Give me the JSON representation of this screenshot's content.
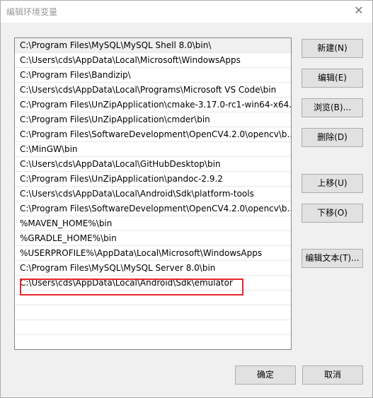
{
  "window": {
    "title": "编辑环境变量",
    "close_glyph": "✕"
  },
  "path_list": {
    "items": [
      "C:\\Program Files\\MySQL\\MySQL Shell 8.0\\bin\\",
      "C:\\Users\\cds\\AppData\\Local\\Microsoft\\WindowsApps",
      "C:\\Program Files\\Bandizip\\",
      "C:\\Users\\cds\\AppData\\Local\\Programs\\Microsoft VS Code\\bin",
      "C:\\Program Files\\UnZipApplication\\cmake-3.17.0-rc1-win64-x64...",
      "C:\\Program Files\\UnZipApplication\\cmder\\bin",
      "C:\\Program Files\\SoftwareDevelopment\\OpenCV4.2.0\\opencv\\b...",
      "C:\\MinGW\\bin",
      "C:\\Users\\cds\\AppData\\Local\\GitHubDesktop\\bin",
      "C:\\Program Files\\UnZipApplication\\pandoc-2.9.2",
      "C:\\Users\\cds\\AppData\\Local\\Android\\Sdk\\platform-tools",
      "C:\\Program Files\\SoftwareDevelopment\\OpenCV4.2.0\\opencv\\b...",
      "%MAVEN_HOME%\\bin",
      "%GRADLE_HOME%\\bin",
      "%USERPROFILE%\\AppData\\Local\\Microsoft\\WindowsApps",
      "C:\\Program Files\\MySQL\\MySQL Server 8.0\\bin",
      "C:\\Users\\cds\\AppData\\Local\\Android\\Sdk\\emulator",
      "",
      "",
      "",
      ""
    ],
    "selected_index": 0,
    "highlight_color": "#e8262c"
  },
  "buttons": {
    "new": "新建(N)",
    "edit": "编辑(E)",
    "browse": "浏览(B)...",
    "delete": "删除(D)",
    "move_up": "上移(U)",
    "move_down": "下移(O)",
    "edit_text": "编辑文本(T)...",
    "ok": "确定",
    "cancel": "取消"
  }
}
